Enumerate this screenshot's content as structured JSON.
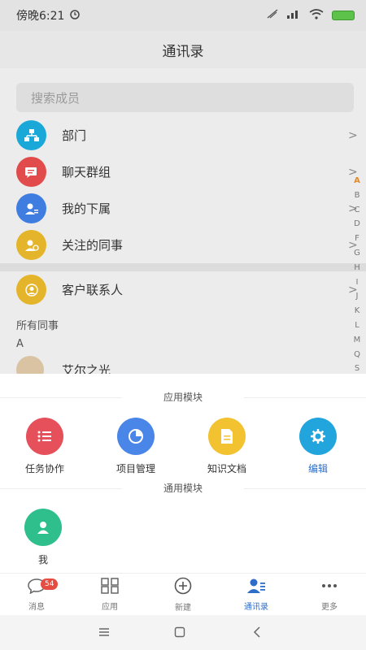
{
  "status": {
    "time": "傍晚6:21"
  },
  "header": {
    "title": "通讯录"
  },
  "search": {
    "placeholder": "搜索成员"
  },
  "menu": [
    {
      "label": "部门",
      "icon": "org-chart-icon",
      "color": "#1aa8d9"
    },
    {
      "label": "聊天群组",
      "icon": "chat-icon",
      "color": "#e14b4b"
    },
    {
      "label": "我的下属",
      "icon": "subordinate-icon",
      "color": "#3f7de0"
    },
    {
      "label": "关注的同事",
      "icon": "followed-colleague-icon",
      "color": "#e4b52a"
    },
    {
      "label": "客户联系人",
      "icon": "customer-contact-icon",
      "color": "#e4b52a"
    }
  ],
  "all_colleagues": {
    "label": "所有同事",
    "letter": "A",
    "first_contact": "艾尔之光"
  },
  "index_letters": [
    "A",
    "B",
    "C",
    "D",
    "F",
    "G",
    "H",
    "I",
    "J",
    "K",
    "L",
    "M",
    "Q",
    "S"
  ],
  "app_modules": {
    "title": "应用模块",
    "items": [
      {
        "label": "任务协作",
        "icon": "task-list-icon",
        "color": "#e6505a"
      },
      {
        "label": "项目管理",
        "icon": "pie-chart-icon",
        "color": "#4a86e8"
      },
      {
        "label": "知识文档",
        "icon": "document-icon",
        "color": "#f2c230"
      },
      {
        "label": "编辑",
        "icon": "gear-icon",
        "color": "#22a5dd"
      }
    ]
  },
  "common_modules": {
    "title": "通用模块",
    "items": [
      {
        "label": "我",
        "icon": "person-icon",
        "color": "#2fbf8d"
      }
    ]
  },
  "tabbar": {
    "items": [
      {
        "label": "消息",
        "icon": "message-icon",
        "badge": "54"
      },
      {
        "label": "应用",
        "icon": "apps-grid-icon"
      },
      {
        "label": "新建",
        "icon": "plus-circle-icon"
      },
      {
        "label": "通讯录",
        "icon": "contacts-icon",
        "active": true
      },
      {
        "label": "更多",
        "icon": "more-dots-icon"
      }
    ]
  }
}
